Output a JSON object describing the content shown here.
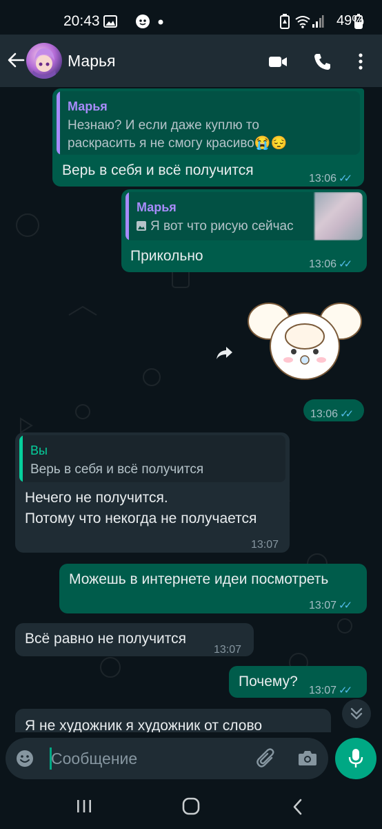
{
  "status_bar": {
    "time": "20:43",
    "battery": "49%"
  },
  "header": {
    "contact_name": "Марья"
  },
  "messages": [
    {
      "id": "m1",
      "direction": "out",
      "quote": {
        "author": "Марья",
        "text_line1": "Незнаю? И если даже куплю то",
        "text_line2": "раскрасить я не смогу красиво😭😔"
      },
      "text": "Верь в себя и всё получится",
      "time": "13:06"
    },
    {
      "id": "m2",
      "direction": "out",
      "quote": {
        "author": "Марья",
        "text": "Я вот что рисую сейчас"
      },
      "text": "Прикольно",
      "time": "13:06"
    },
    {
      "id": "m3",
      "direction": "out",
      "type": "sticker",
      "time": "13:06"
    },
    {
      "id": "m4",
      "direction": "in",
      "quote": {
        "author": "Вы",
        "text": "Верь в себя и всё получится"
      },
      "text_line1": "Нечего не получится.",
      "text_line2": "Потому что некогда не получается",
      "time": "13:07"
    },
    {
      "id": "m5",
      "direction": "out",
      "text": "Можешь в интернете идеи посмотреть",
      "time": "13:07"
    },
    {
      "id": "m6",
      "direction": "in",
      "text": "Всё равно не получится",
      "time": "13:07"
    },
    {
      "id": "m7",
      "direction": "out",
      "text": "Почему?",
      "time": "13:07"
    },
    {
      "id": "m8",
      "direction": "in",
      "text": "Я не художник я художник от слово"
    }
  ],
  "composer": {
    "placeholder": "Сообщение"
  },
  "colors": {
    "background": "#0b141a",
    "header": "#1f2c34",
    "outgoing_bubble": "#005c4b",
    "incoming_bubble": "#1f2c34",
    "accent": "#00a884",
    "read_ticks": "#53bdeb",
    "quote_author_purple": "#a78bfa",
    "quote_author_green": "#06cf9c"
  },
  "icons": {
    "header": [
      "back-arrow-icon",
      "video-call-icon",
      "voice-call-icon",
      "more-options-icon"
    ],
    "composer": [
      "emoji-icon",
      "attach-icon",
      "camera-icon",
      "microphone-icon"
    ],
    "nav": [
      "recent-apps-icon",
      "home-icon",
      "back-nav-icon"
    ]
  }
}
